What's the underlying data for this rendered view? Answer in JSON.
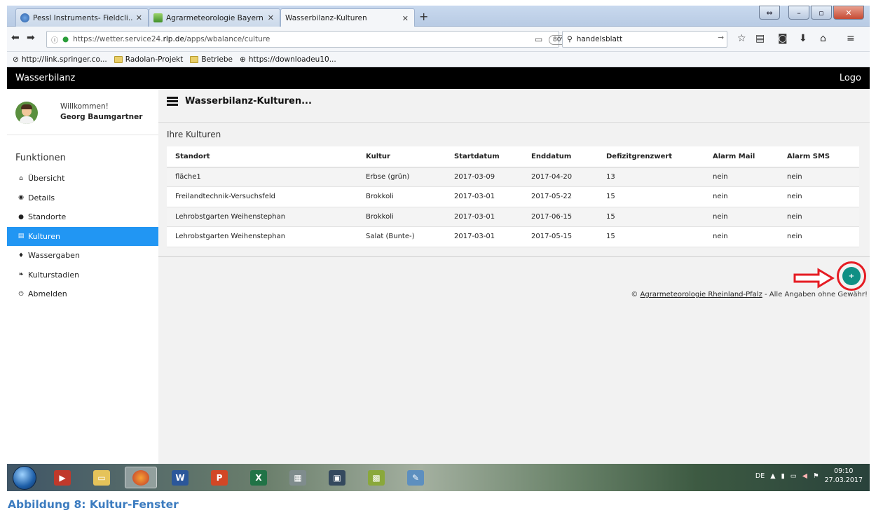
{
  "browser": {
    "tabs": [
      {
        "title": "Pessl Instruments- Fieldcli...",
        "active": false
      },
      {
        "title": "Agrarmeteorologie Bayern",
        "active": false
      },
      {
        "title": "Wasserbilanz-Kulturen",
        "active": true
      }
    ],
    "url_prefix": "https://wetter.service24.",
    "url_host": "rlp.de",
    "url_path": "/apps/wbalance/culture",
    "zoom": "80%",
    "search_value": "handelsblatt",
    "bookmarks": [
      {
        "label": "http://link.springer.co...",
        "icon": "link-icon"
      },
      {
        "label": "Radolan-Projekt",
        "icon": "folder-icon"
      },
      {
        "label": "Betriebe",
        "icon": "folder-icon"
      },
      {
        "label": "https://downloadeu10...",
        "icon": "globe-icon"
      }
    ]
  },
  "app": {
    "brand": "Wasserbilanz",
    "logo": "Logo",
    "welcome": "Willkommen!",
    "user_name": "Georg Baumgartner",
    "menu_heading": "Funktionen",
    "menu": [
      {
        "label": "Übersicht",
        "icon": "home-icon",
        "active": false
      },
      {
        "label": "Details",
        "icon": "eye-icon",
        "active": false
      },
      {
        "label": "Standorte",
        "icon": "map-marker-icon",
        "active": false
      },
      {
        "label": "Kulturen",
        "icon": "list-icon",
        "active": true
      },
      {
        "label": "Wassergaben",
        "icon": "drop-icon",
        "active": false
      },
      {
        "label": "Kulturstadien",
        "icon": "leaf-icon",
        "active": false
      },
      {
        "label": "Abmelden",
        "icon": "power-icon",
        "active": false
      }
    ],
    "page_title": "Wasserbilanz-Kulturen...",
    "section_title": "Ihre Kulturen",
    "table": {
      "columns": [
        "Standort",
        "Kultur",
        "Startdatum",
        "Enddatum",
        "Defizitgrenzwert",
        "Alarm Mail",
        "Alarm SMS"
      ],
      "rows": [
        [
          "fläche1",
          "Erbse (grün)",
          "2017-03-09",
          "2017-04-20",
          "13",
          "nein",
          "nein"
        ],
        [
          "Freilandtechnik-Versuchsfeld",
          "Brokkoli",
          "2017-03-01",
          "2017-05-22",
          "15",
          "nein",
          "nein"
        ],
        [
          "Lehrobstgarten Weihenstephan",
          "Brokkoli",
          "2017-03-01",
          "2017-06-15",
          "15",
          "nein",
          "nein"
        ],
        [
          "Lehrobstgarten Weihenstephan",
          "Salat (Bunte-)",
          "2017-03-01",
          "2017-05-15",
          "15",
          "nein",
          "nein"
        ]
      ]
    },
    "add_button": "+",
    "copyright_prefix": "©",
    "copyright_link": "Agrarmeteorologie Rheinland-Pfalz",
    "copyright_suffix": "- Alle Angaben ohne Gewähr!"
  },
  "taskbar": {
    "lang": "DE",
    "time": "09:10",
    "date": "27.03.2017"
  },
  "caption": "Abbildung 8: Kultur-Fenster",
  "colors": {
    "accent": "#2196f3",
    "fab": "#0f8f84",
    "annotation": "#e51c23",
    "caption": "#3b7bbf"
  }
}
